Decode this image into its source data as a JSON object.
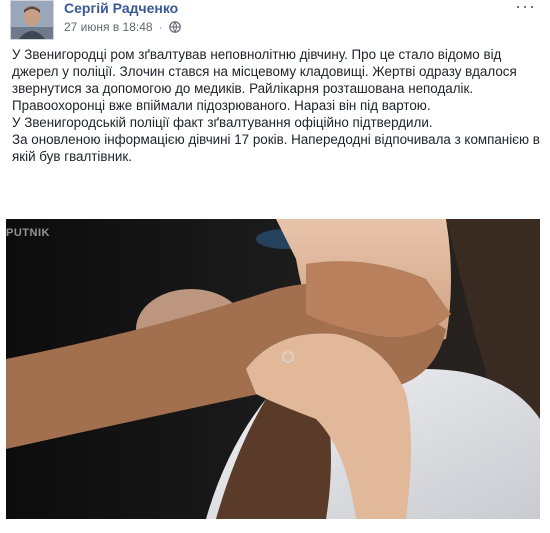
{
  "post": {
    "author": "Сергій Радченко",
    "timestamp": "27 июня в 18:48",
    "separator": "·",
    "privacy_icon": "globe-icon",
    "options_icon": "more-options-icon",
    "options_glyph": "···",
    "paragraphs": [
      "У Звенигородці ром зґвалтував неповнолітню дівчину. Про це стало відомо від джерел у поліції. Злочин стався на місцевому кладовищі. Жертві одразу вдалося звернутися за допомогою до медиків. Райлікарня розташована неподалік. Правоохоронці вже впіймали підозрюваного. Наразі він під вартою.",
      "У Звенигородській поліції факт зґвалтування офіційно підтвердили.",
      "За оновленою інформацією дівчині 17 років. Напередодні відпочивала з компанією в якій був гвалтівник."
    ],
    "photo": {
      "watermark": "PUTNIK"
    }
  },
  "colors": {
    "author": "#385898",
    "meta": "#616770",
    "text": "#1d2129"
  }
}
